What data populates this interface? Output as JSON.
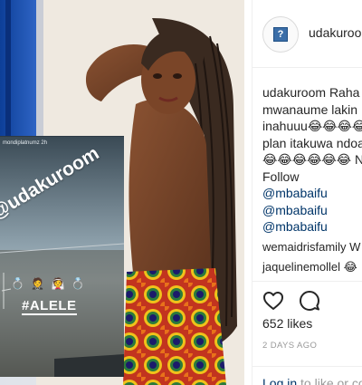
{
  "post": {
    "story_overlay": {
      "username": "mondiplatnumz",
      "age": "2h",
      "handle": "@udakuroom",
      "emojis": "💍 🤵 👰 💍",
      "hashtag": "#ALELE"
    }
  },
  "header": {
    "username": "udakuroom",
    "avatar_glyph": "?"
  },
  "caption": {
    "username": "udakuroom",
    "lines": [
      "Raha",
      "mwanaume lakin",
      "inahuuu😂😂😂😂",
      "plan itakuwa ndoa",
      "😂😂😂😂😂😂 N",
      "Follow"
    ],
    "mentions": [
      "@mbabaifu",
      "@mbabaifu",
      "@mbabaifu"
    ]
  },
  "comments": [
    {
      "username": "wemaidrisfamily",
      "text": "W"
    },
    {
      "username": "jaquelinemollel",
      "text": "😂"
    }
  ],
  "actions": {
    "like_icon": "heart-outline-icon",
    "comment_icon": "speech-bubble-icon"
  },
  "likes_text": "652 likes",
  "time_text": "2 DAYS AGO",
  "login": {
    "link_text": "Log in",
    "rest_text": " to like or com"
  },
  "colors": {
    "link": "#003569",
    "muted": "#999999",
    "text": "#262626",
    "border": "#efefef"
  }
}
